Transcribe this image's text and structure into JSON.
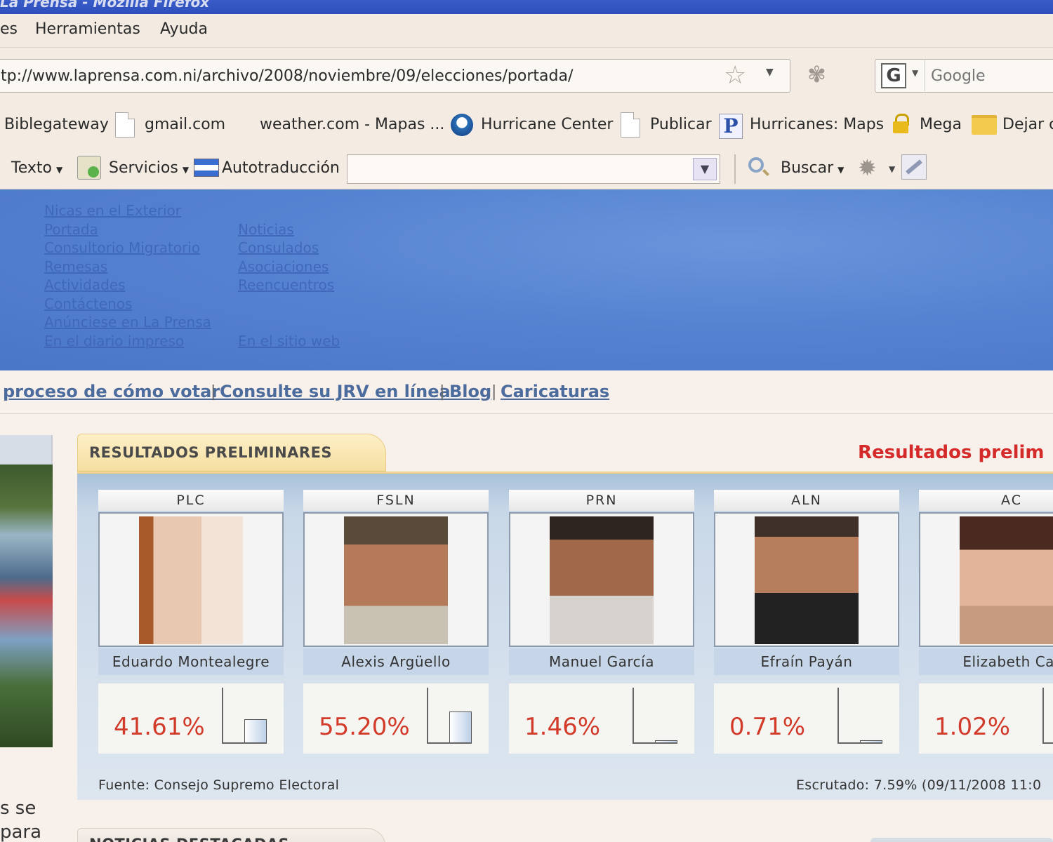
{
  "window": {
    "title": "La Prensa - Mozilla Firefox"
  },
  "menu": {
    "items": [
      "es",
      "Herramientas",
      "Ayuda"
    ]
  },
  "nav": {
    "url": "tp://www.laprensa.com.ni/archivo/2008/noviembre/09/elecciones/portada/",
    "search_placeholder": "Google"
  },
  "bookmarks": [
    "Biblegateway",
    "gmail.com",
    "weather.com - Mapas ...",
    "Hurricane Center",
    "Publicar",
    "Hurricanes: Maps",
    "Mega",
    "Dejar c"
  ],
  "toolbar": {
    "texto": "Texto",
    "servicios": "Servicios",
    "autotraduccion": "Autotraducción",
    "buscar": "Buscar"
  },
  "site_menu": {
    "left": [
      "Nicas en el Exterior",
      "Portada",
      "Consultorio Migratorio",
      "Remesas",
      "Actividades",
      "Contáctenos",
      "Anúnciese en La Prensa",
      "En el diario impreso"
    ],
    "right": [
      "Noticias",
      "Consulados",
      "Asociaciones",
      "Reencuentros",
      "En el sitio web"
    ]
  },
  "site_nav": [
    "proceso de cómo votar",
    "Consulte su JRV en línea",
    "Blog",
    "Caricaturas"
  ],
  "site_nav_separator": "|",
  "left_snippet": [
    "s se",
    "para"
  ],
  "results": {
    "tab_title": "RESULTADOS PRELIMINARES",
    "heading": "Resultados prelim",
    "candidates": [
      {
        "party": "PLC",
        "name": "Eduardo Montealegre",
        "percent": "41.61%",
        "share": 0.4161
      },
      {
        "party": "FSLN",
        "name": "Alexis Argüello",
        "percent": "55.20%",
        "share": 0.552
      },
      {
        "party": "PRN",
        "name": "Manuel García",
        "percent": "1.46%",
        "share": 0.0146
      },
      {
        "party": "ALN",
        "name": "Efraín Payán",
        "percent": "0.71%",
        "share": 0.0071
      },
      {
        "party": "AC",
        "name": "Elizabeth Car",
        "percent": "1.02%",
        "share": 0.0102
      }
    ],
    "source": "Fuente: Consejo Supremo Electoral",
    "scrutiny": "Escrutado: 7.59% (09/11/2008 11:0"
  },
  "news": {
    "tab_title": "NOTICIAS DESTACADAS"
  },
  "colors": {
    "accent_red": "#d23a2a",
    "link_blue": "#4d6c9e",
    "band_blue": "#5683d1"
  }
}
